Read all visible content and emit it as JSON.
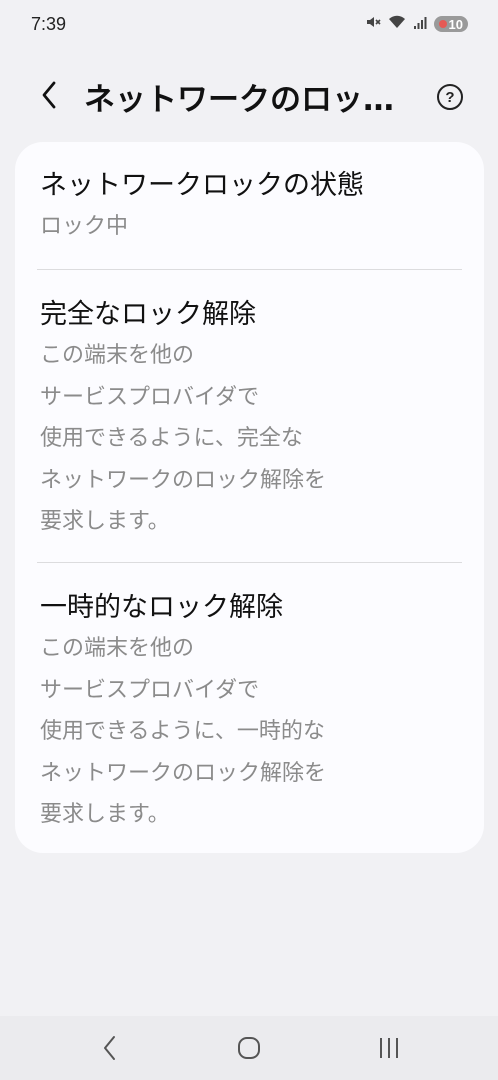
{
  "status_bar": {
    "time": "7:39",
    "battery_level": "10",
    "icons": [
      "mute-icon",
      "wifi-icon",
      "signal-icon",
      "battery-icon"
    ]
  },
  "app_bar": {
    "title": "ネットワークのロック解除",
    "back_icon": "back-chevron-icon",
    "help_icon": "help-circle-icon",
    "help_glyph": "?"
  },
  "items": [
    {
      "title": "ネットワークロックの状態",
      "subtitle": "ロック中"
    },
    {
      "title": "完全なロック解除",
      "subtitle": "この端末を他の\nサービスプロバイダで\n使用できるように、完全な\nネットワークのロック解除を\n要求します。"
    },
    {
      "title": "一時的なロック解除",
      "subtitle": "この端末を他の\nサービスプロバイダで\n使用できるように、一時的な\nネットワークのロック解除を\n要求します。"
    }
  ],
  "nav_bar": {
    "buttons": [
      "back-nav-icon",
      "home-nav-icon",
      "recents-nav-icon"
    ]
  },
  "colors": {
    "background": "#f1f1f4",
    "card": "#fcfcff",
    "subtitle_text": "#8b8b8b",
    "battery_low": "#e65a55"
  }
}
